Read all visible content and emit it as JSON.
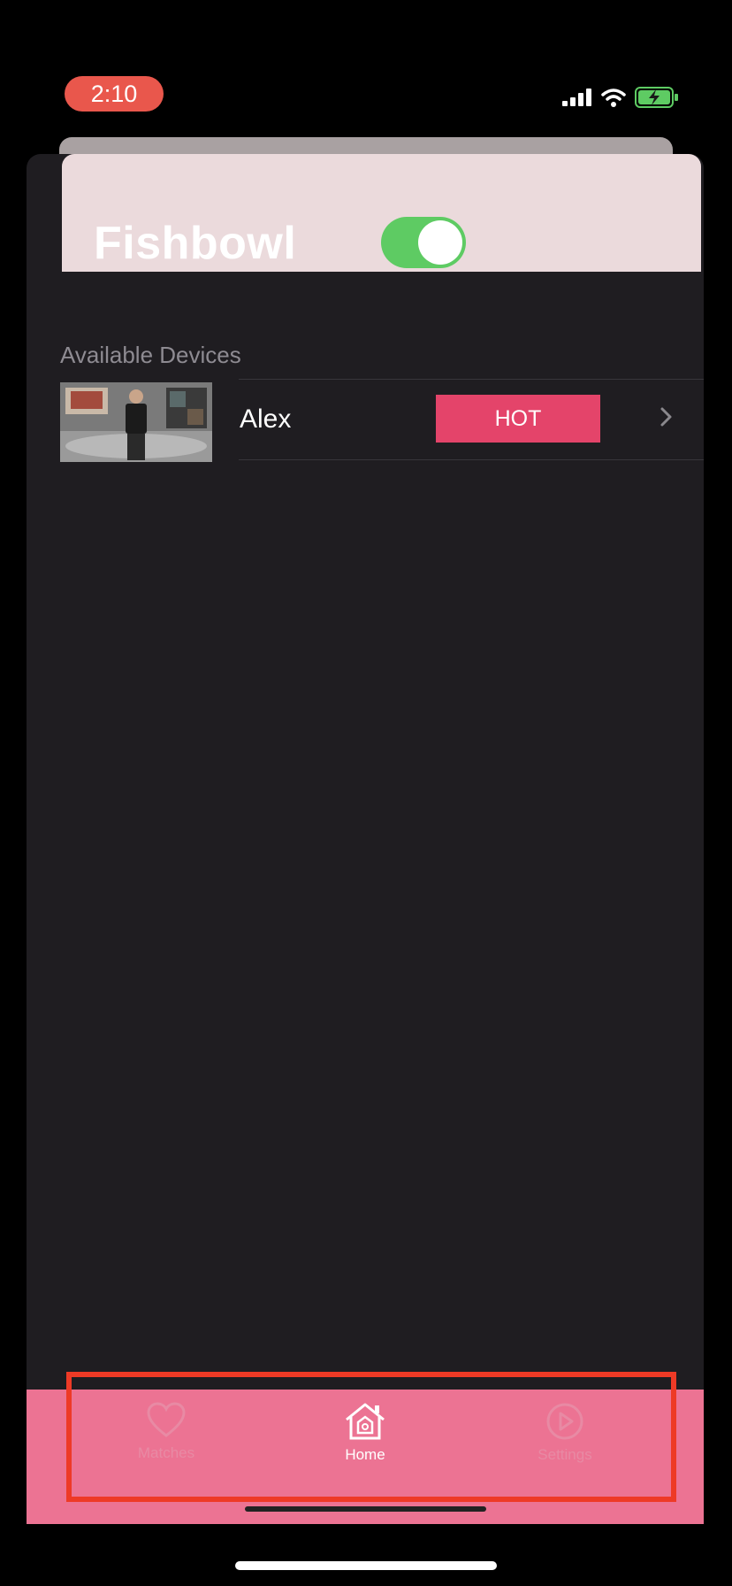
{
  "status_bar": {
    "time": "2:10",
    "icons": [
      "signal-icon",
      "wifi-icon",
      "battery-charging-icon"
    ],
    "time_pill_color": "#e9574c"
  },
  "header": {
    "title": "Fishbowl",
    "toggle_on": true,
    "toggle_color": "#5ecb63"
  },
  "section": {
    "label": "Available Devices"
  },
  "devices": [
    {
      "name": "Alex",
      "badge": "HOT",
      "badge_color": "#e4446a"
    }
  ],
  "tabbar": {
    "background": "#ec7393",
    "tabs": [
      {
        "label": "Matches",
        "icon": "heart-icon",
        "active": false
      },
      {
        "label": "Home",
        "icon": "home-icon",
        "active": true
      },
      {
        "label": "Settings",
        "icon": "play-circle-icon",
        "active": false
      }
    ]
  },
  "annotation_color": "#ee3a26"
}
